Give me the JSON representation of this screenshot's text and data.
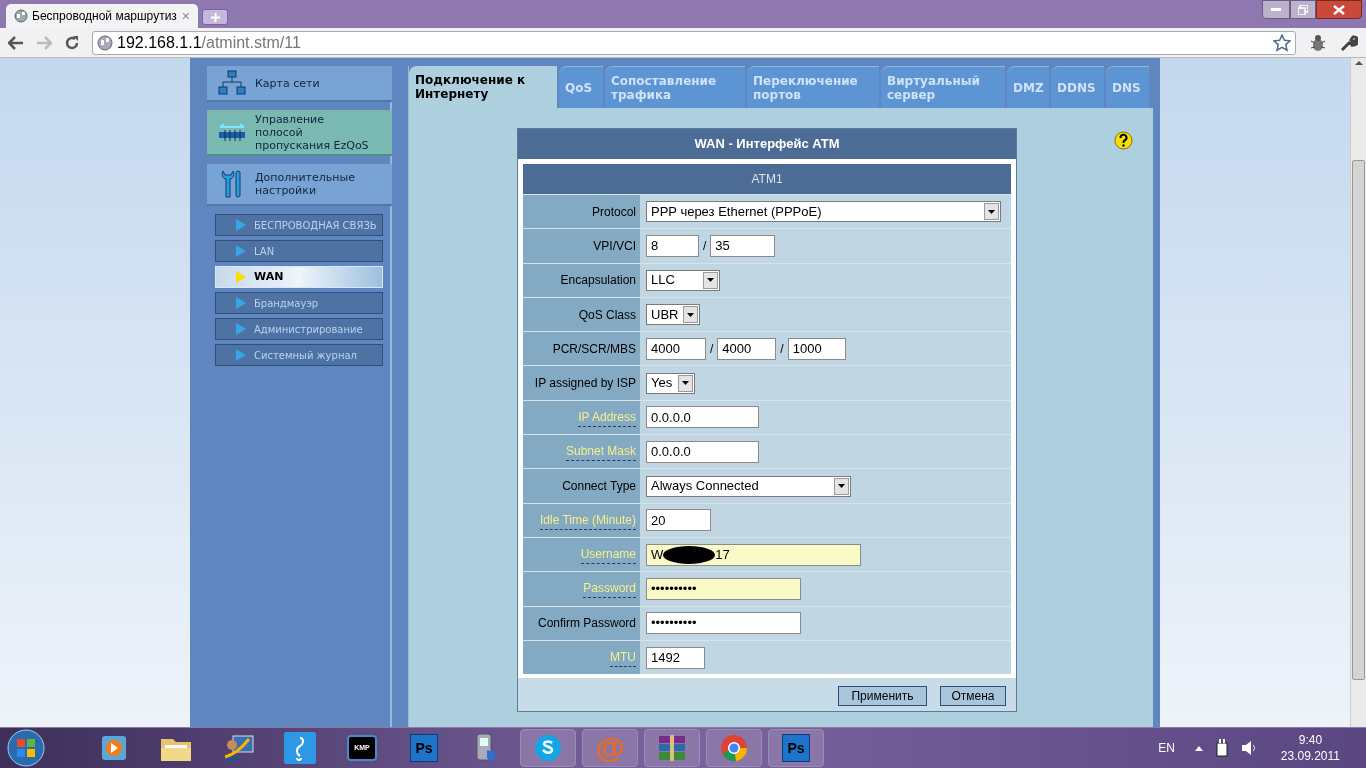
{
  "browser": {
    "tab_title": "Беспроводной маршрутиз",
    "tab_close": "×",
    "url_host": "192.168.1.1",
    "url_path": "/atmint.stm/11"
  },
  "sidebar": {
    "main_items": [
      {
        "label": "Карта сети",
        "kind": "map",
        "highlighted": false
      },
      {
        "label": "Управление полосой пропускания EzQoS",
        "kind": "qos",
        "highlighted": true
      },
      {
        "label": "Дополнительные настройки",
        "kind": "tools",
        "highlighted": false
      }
    ],
    "sub_items": [
      {
        "label": "БЕСПРОВОДНАЯ СВЯЗЬ",
        "selected": false
      },
      {
        "label": "LAN",
        "selected": false
      },
      {
        "label": "WAN",
        "selected": true
      },
      {
        "label": "Брандмауэр",
        "selected": false
      },
      {
        "label": "Администрирование",
        "selected": false
      },
      {
        "label": "Системный журнал",
        "selected": false
      }
    ]
  },
  "tabs": [
    {
      "label": "Подключение к Интернету",
      "selected": true
    },
    {
      "label": "QoS",
      "selected": false
    },
    {
      "label": "Сопоставление трафика",
      "selected": false
    },
    {
      "label": "Переключение портов",
      "selected": false
    },
    {
      "label": "Виртуальный сервер",
      "selected": false
    },
    {
      "label": "DMZ",
      "selected": false
    },
    {
      "label": "DDNS",
      "selected": false
    },
    {
      "label": "DNS",
      "selected": false
    }
  ],
  "form": {
    "title": "WAN - Интерфейс ATM",
    "subtitle": "ATM1",
    "rows": [
      {
        "label": "Protocol",
        "help": false,
        "kind": "select",
        "value": "PPP через Ethernet (PPPoE)"
      },
      {
        "label": "VPI/VCI",
        "help": false,
        "kind": "inputs",
        "separator": "/",
        "values": [
          "8",
          "35"
        ]
      },
      {
        "label": "Encapsulation",
        "help": false,
        "kind": "select",
        "value": "LLC"
      },
      {
        "label": "QoS Class",
        "help": false,
        "kind": "select",
        "value": "UBR"
      },
      {
        "label": "PCR/SCR/MBS",
        "help": false,
        "kind": "inputs",
        "separator": "/",
        "values": [
          "4000",
          "4000",
          "1000"
        ]
      },
      {
        "label": "IP assigned by ISP",
        "help": false,
        "kind": "select",
        "value": "Yes"
      },
      {
        "label": "IP Address",
        "help": true,
        "kind": "input",
        "value": "0.0.0.0",
        "autofill": false
      },
      {
        "label": "Subnet Mask",
        "help": true,
        "kind": "input",
        "value": "0.0.0.0",
        "autofill": false
      },
      {
        "label": "Connect Type",
        "help": false,
        "kind": "select",
        "value": "Always Connected"
      },
      {
        "label": "Idle Time (Minute)",
        "help": true,
        "kind": "input",
        "value": "20",
        "autofill": false
      },
      {
        "label": "Username",
        "help": true,
        "kind": "redacted",
        "value": "W",
        "value_end": "17",
        "autofill": true
      },
      {
        "label": "Password",
        "help": true,
        "kind": "input",
        "value": "••••••••••",
        "autofill": true
      },
      {
        "label": "Confirm Password",
        "help": false,
        "kind": "input",
        "value": "••••••••••",
        "autofill": false
      },
      {
        "label": "MTU",
        "help": true,
        "kind": "input",
        "value": "1492",
        "autofill": false
      }
    ],
    "buttons": [
      "Применить",
      "Отмена"
    ]
  },
  "taskbar": {
    "apps": [
      {
        "kind": "media",
        "running": false
      },
      {
        "kind": "folder",
        "running": false
      },
      {
        "kind": "remote",
        "running": false
      },
      {
        "kind": "music",
        "running": false
      },
      {
        "kind": "kmp",
        "label": "KMP",
        "running": false
      },
      {
        "kind": "ps",
        "label": "Ps",
        "running": false
      },
      {
        "kind": "device",
        "running": false
      },
      {
        "kind": "skype",
        "running": true
      },
      {
        "kind": "mail",
        "label": "@",
        "running": true
      },
      {
        "kind": "archive",
        "running": true
      },
      {
        "kind": "chrome",
        "running": true
      },
      {
        "kind": "ps",
        "label": "Ps",
        "running": true
      }
    ],
    "language": "EN",
    "time": "9:40",
    "date": "23.09.2011"
  }
}
